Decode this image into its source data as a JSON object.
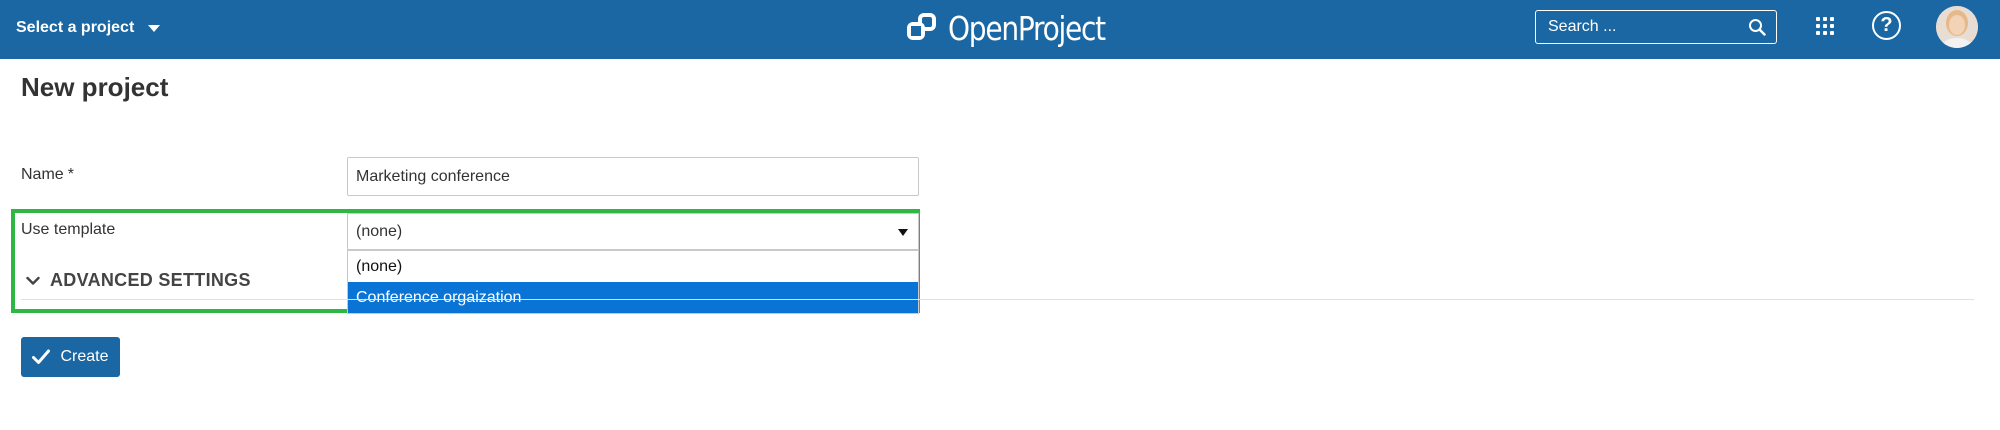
{
  "header": {
    "project_select_label": "Select a project",
    "logo_text": "OpenProject",
    "search_placeholder": "Search ...",
    "bg_color": "#1a67a3"
  },
  "page": {
    "title": "New project"
  },
  "form": {
    "name_label": "Name",
    "required_marker": "*",
    "name_value": "Marketing conference",
    "template_label": "Use template",
    "template_selected": "(none)",
    "template_options": [
      "(none)",
      "Conference orgaization"
    ],
    "advanced_settings_label": "ADVANCED SETTINGS",
    "create_label": "Create"
  },
  "colors": {
    "highlight_border": "#2eb843",
    "option_selected": "#0a74d6",
    "button": "#1a67a3"
  },
  "icons": {
    "caret": "chevron-down-icon",
    "search": "search-icon",
    "apps": "grid-icon",
    "help": "help-icon",
    "check": "check-icon"
  }
}
